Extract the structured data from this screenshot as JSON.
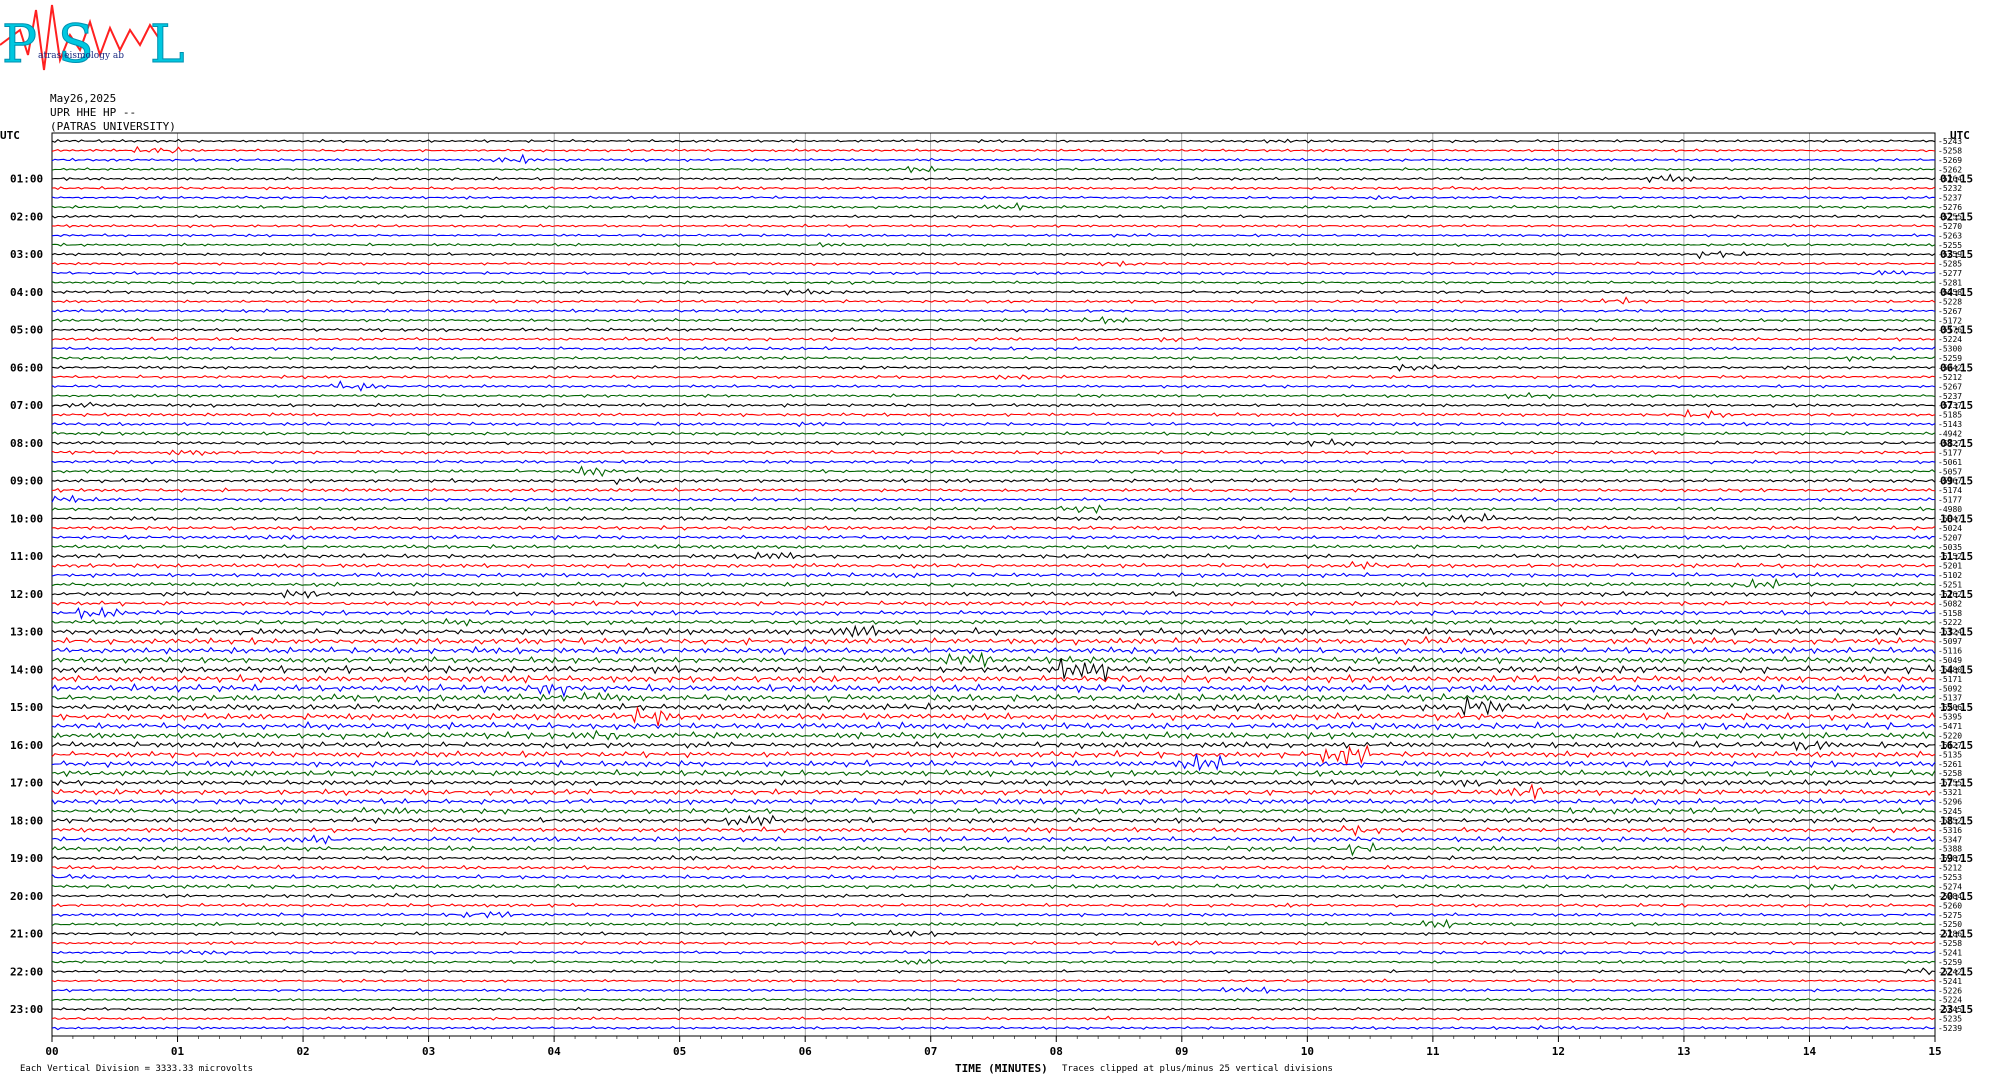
{
  "header": {
    "logo_text": "PSL",
    "logo_full": "Patras Seismology Lab",
    "date": "May26,2025",
    "station": "UPR HHE HP --",
    "institution": "(PATRAS UNIVERSITY)"
  },
  "footer": {
    "left_note": "Each Vertical Division = 3333.33 microvolts",
    "xlabel": "TIME (MINUTES)",
    "right_note": "Traces clipped at plus/minus 25 vertical divisions"
  },
  "colors": {
    "cycle": [
      "#000000",
      "#ff0000",
      "#0000ff",
      "#006400"
    ],
    "grid": "#000000"
  },
  "chart_data": {
    "type": "line",
    "xlabel": "TIME (MINUTES)",
    "xlim": [
      0,
      15
    ],
    "x_ticks": [
      "00",
      "01",
      "02",
      "03",
      "04",
      "05",
      "06",
      "07",
      "08",
      "09",
      "10",
      "11",
      "12",
      "13",
      "14",
      "15"
    ],
    "left_axis_title": "UTC",
    "right_axis_title": "UTC",
    "left_hour_labels": [
      "01:00",
      "02:00",
      "03:00",
      "04:00",
      "05:00",
      "06:00",
      "07:00",
      "08:00",
      "09:00",
      "10:00",
      "11:00",
      "12:00",
      "13:00",
      "14:00",
      "15:00",
      "16:00",
      "17:00",
      "18:00",
      "19:00",
      "20:00",
      "21:00",
      "22:00",
      "23:00"
    ],
    "right_hour_labels": [
      "01:15",
      "02:15",
      "03:15",
      "04:15",
      "05:15",
      "06:15",
      "07:15",
      "08:15",
      "09:15",
      "10:15",
      "11:15",
      "12:15",
      "13:15",
      "14:15",
      "15:15",
      "16:15",
      "17:15",
      "18:15",
      "19:15",
      "20:15",
      "21:15",
      "22:15",
      "23:15"
    ],
    "trace_offsets": [
      "-5243",
      "-5258",
      "-5269",
      "-5262",
      "-5264",
      "-5232",
      "-5237",
      "-5276",
      "-5255",
      "-5270",
      "-5263",
      "-5255",
      "-5259",
      "-5285",
      "-5277",
      "-5281",
      "-5258",
      "-5228",
      "-5267",
      "-5172",
      "-5176",
      "-5224",
      "-5300",
      "-5259",
      "-5242",
      "-5212",
      "-5267",
      "-5237",
      "-5237",
      "-5185",
      "-5143",
      "-4942",
      "-5127",
      "-5177",
      "-5061",
      "-5057",
      "-5167",
      "-5174",
      "-5177",
      "-4980",
      "-5047",
      "-5024",
      "-5207",
      "-5035",
      "-5152",
      "-5201",
      "-5102",
      "-5251",
      "-5162",
      "-5082",
      "-5158",
      "-5222",
      "-5124",
      "-5097",
      "-5116",
      "-5049",
      "-5380",
      "-5171",
      "-5092",
      "-5137",
      "-5206",
      "-5395",
      "-5471",
      "-5220",
      "-5127",
      "-5135",
      "-5261",
      "-5258",
      "-5255",
      "-5321",
      "-5296",
      "-5245",
      "-5252",
      "-5316",
      "-5347",
      "-5388",
      "-5287",
      "-5212",
      "-5253",
      "-5274",
      "-5284",
      "-5260",
      "-5275",
      "-5250",
      "-5286",
      "-5258",
      "-5241",
      "-5259",
      "-5242",
      "-5241",
      "-5226",
      "-5224",
      "-5245",
      "-5235",
      "-5239"
    ],
    "trace_count": 95,
    "traces_per_hour": 4,
    "noise_profile_by_hour": [
      1,
      1,
      1,
      1,
      1.1,
      1.2,
      1.1,
      1.2,
      1.2,
      1.3,
      1.4,
      1.5,
      1.6,
      2.3,
      2.6,
      2.4,
      2.2,
      2.0,
      1.8,
      1.4,
      1.2,
      1.1,
      1.0,
      1.0
    ]
  }
}
